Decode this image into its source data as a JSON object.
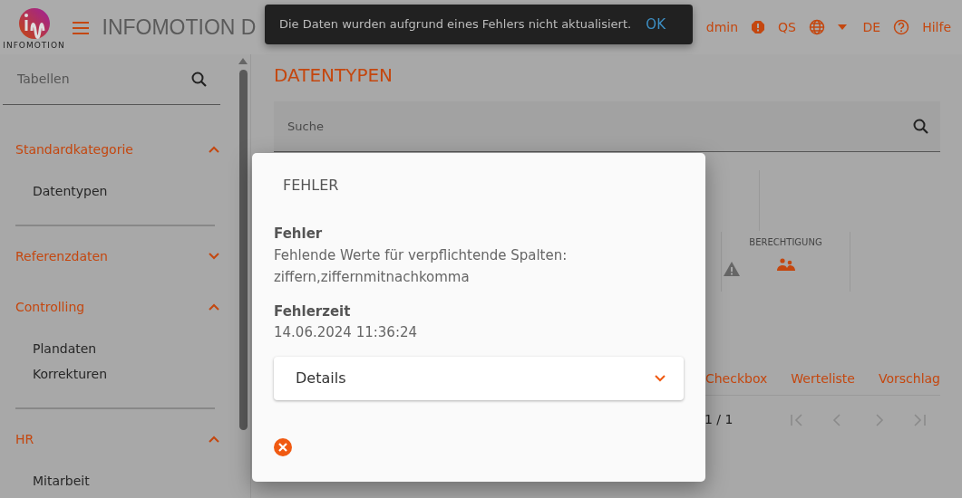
{
  "header": {
    "logo_text": "INFOMOTION",
    "title": "INFOMOTION D",
    "user": "dmin",
    "stage": "QS",
    "language": "DE",
    "help": "Hilfe"
  },
  "toast": {
    "message": "Die Daten wurden aufgrund eines Fehlers nicht aktualisiert.",
    "action": "OK"
  },
  "sidebar": {
    "search": {
      "placeholder": "Tabellen"
    },
    "groups": [
      {
        "label": "Standardkategorie",
        "expanded": true,
        "items": [
          {
            "label": "Datentypen"
          }
        ]
      },
      {
        "label": "Referenzdaten",
        "expanded": false
      },
      {
        "label": "Controlling",
        "expanded": true,
        "items": [
          {
            "label": "Plandaten"
          },
          {
            "label": "Korrekturen"
          }
        ]
      },
      {
        "label": "HR",
        "expanded": true,
        "items": [
          {
            "label": "Mitarbeit"
          }
        ]
      }
    ]
  },
  "main": {
    "title": "DATENTYPEN",
    "search": {
      "placeholder": "Suche"
    },
    "column_header": "BERECHTIGUNG",
    "tabs": [
      {
        "label": "Checkbox",
        "selected": false
      },
      {
        "label": "Werteliste",
        "selected": false
      },
      {
        "label": "Vorschlag",
        "selected": false
      }
    ],
    "pagination": "1 / 1"
  },
  "dialog": {
    "title": "FEHLER",
    "fields": [
      {
        "label": "Fehler",
        "value": "Fehlende Werte für verpflichtende Spalten: ziffern,ziffernmitnachkomma"
      },
      {
        "label": "Fehlerzeit",
        "value": "14.06.2024 11:36:24"
      }
    ],
    "details": {
      "label": "Details",
      "expanded": false
    }
  }
}
